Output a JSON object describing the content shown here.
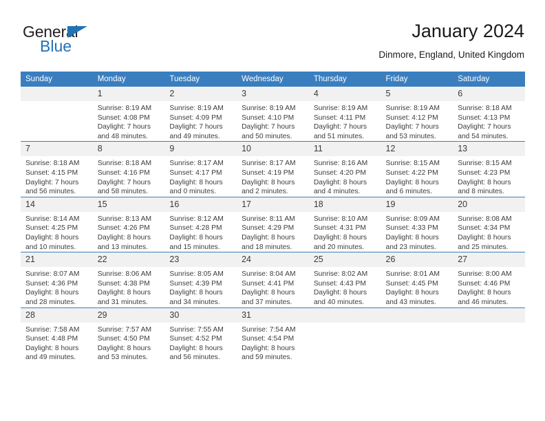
{
  "brand": {
    "name_part1": "General",
    "name_part2": "Blue",
    "triangle_color": "#2272b5"
  },
  "header": {
    "title": "January 2024",
    "subtitle": "Dinmore, England, United Kingdom"
  },
  "theme": {
    "header_blue": "#3a7ebf",
    "row_gray": "#f1f1f1",
    "text": "#3c3c3c"
  },
  "calendar": {
    "weekday_headers": [
      "Sunday",
      "Monday",
      "Tuesday",
      "Wednesday",
      "Thursday",
      "Friday",
      "Saturday"
    ],
    "weeks": [
      [
        {
          "day": "",
          "blank": true
        },
        {
          "day": "1",
          "sunrise": "Sunrise: 8:19 AM",
          "sunset": "Sunset: 4:08 PM",
          "daylight_l1": "Daylight: 7 hours",
          "daylight_l2": "and 48 minutes."
        },
        {
          "day": "2",
          "sunrise": "Sunrise: 8:19 AM",
          "sunset": "Sunset: 4:09 PM",
          "daylight_l1": "Daylight: 7 hours",
          "daylight_l2": "and 49 minutes."
        },
        {
          "day": "3",
          "sunrise": "Sunrise: 8:19 AM",
          "sunset": "Sunset: 4:10 PM",
          "daylight_l1": "Daylight: 7 hours",
          "daylight_l2": "and 50 minutes."
        },
        {
          "day": "4",
          "sunrise": "Sunrise: 8:19 AM",
          "sunset": "Sunset: 4:11 PM",
          "daylight_l1": "Daylight: 7 hours",
          "daylight_l2": "and 51 minutes."
        },
        {
          "day": "5",
          "sunrise": "Sunrise: 8:19 AM",
          "sunset": "Sunset: 4:12 PM",
          "daylight_l1": "Daylight: 7 hours",
          "daylight_l2": "and 53 minutes."
        },
        {
          "day": "6",
          "sunrise": "Sunrise: 8:18 AM",
          "sunset": "Sunset: 4:13 PM",
          "daylight_l1": "Daylight: 7 hours",
          "daylight_l2": "and 54 minutes."
        }
      ],
      [
        {
          "day": "7",
          "sunrise": "Sunrise: 8:18 AM",
          "sunset": "Sunset: 4:15 PM",
          "daylight_l1": "Daylight: 7 hours",
          "daylight_l2": "and 56 minutes."
        },
        {
          "day": "8",
          "sunrise": "Sunrise: 8:18 AM",
          "sunset": "Sunset: 4:16 PM",
          "daylight_l1": "Daylight: 7 hours",
          "daylight_l2": "and 58 minutes."
        },
        {
          "day": "9",
          "sunrise": "Sunrise: 8:17 AM",
          "sunset": "Sunset: 4:17 PM",
          "daylight_l1": "Daylight: 8 hours",
          "daylight_l2": "and 0 minutes."
        },
        {
          "day": "10",
          "sunrise": "Sunrise: 8:17 AM",
          "sunset": "Sunset: 4:19 PM",
          "daylight_l1": "Daylight: 8 hours",
          "daylight_l2": "and 2 minutes."
        },
        {
          "day": "11",
          "sunrise": "Sunrise: 8:16 AM",
          "sunset": "Sunset: 4:20 PM",
          "daylight_l1": "Daylight: 8 hours",
          "daylight_l2": "and 4 minutes."
        },
        {
          "day": "12",
          "sunrise": "Sunrise: 8:15 AM",
          "sunset": "Sunset: 4:22 PM",
          "daylight_l1": "Daylight: 8 hours",
          "daylight_l2": "and 6 minutes."
        },
        {
          "day": "13",
          "sunrise": "Sunrise: 8:15 AM",
          "sunset": "Sunset: 4:23 PM",
          "daylight_l1": "Daylight: 8 hours",
          "daylight_l2": "and 8 minutes."
        }
      ],
      [
        {
          "day": "14",
          "sunrise": "Sunrise: 8:14 AM",
          "sunset": "Sunset: 4:25 PM",
          "daylight_l1": "Daylight: 8 hours",
          "daylight_l2": "and 10 minutes."
        },
        {
          "day": "15",
          "sunrise": "Sunrise: 8:13 AM",
          "sunset": "Sunset: 4:26 PM",
          "daylight_l1": "Daylight: 8 hours",
          "daylight_l2": "and 13 minutes."
        },
        {
          "day": "16",
          "sunrise": "Sunrise: 8:12 AM",
          "sunset": "Sunset: 4:28 PM",
          "daylight_l1": "Daylight: 8 hours",
          "daylight_l2": "and 15 minutes."
        },
        {
          "day": "17",
          "sunrise": "Sunrise: 8:11 AM",
          "sunset": "Sunset: 4:29 PM",
          "daylight_l1": "Daylight: 8 hours",
          "daylight_l2": "and 18 minutes."
        },
        {
          "day": "18",
          "sunrise": "Sunrise: 8:10 AM",
          "sunset": "Sunset: 4:31 PM",
          "daylight_l1": "Daylight: 8 hours",
          "daylight_l2": "and 20 minutes."
        },
        {
          "day": "19",
          "sunrise": "Sunrise: 8:09 AM",
          "sunset": "Sunset: 4:33 PM",
          "daylight_l1": "Daylight: 8 hours",
          "daylight_l2": "and 23 minutes."
        },
        {
          "day": "20",
          "sunrise": "Sunrise: 8:08 AM",
          "sunset": "Sunset: 4:34 PM",
          "daylight_l1": "Daylight: 8 hours",
          "daylight_l2": "and 25 minutes."
        }
      ],
      [
        {
          "day": "21",
          "sunrise": "Sunrise: 8:07 AM",
          "sunset": "Sunset: 4:36 PM",
          "daylight_l1": "Daylight: 8 hours",
          "daylight_l2": "and 28 minutes."
        },
        {
          "day": "22",
          "sunrise": "Sunrise: 8:06 AM",
          "sunset": "Sunset: 4:38 PM",
          "daylight_l1": "Daylight: 8 hours",
          "daylight_l2": "and 31 minutes."
        },
        {
          "day": "23",
          "sunrise": "Sunrise: 8:05 AM",
          "sunset": "Sunset: 4:39 PM",
          "daylight_l1": "Daylight: 8 hours",
          "daylight_l2": "and 34 minutes."
        },
        {
          "day": "24",
          "sunrise": "Sunrise: 8:04 AM",
          "sunset": "Sunset: 4:41 PM",
          "daylight_l1": "Daylight: 8 hours",
          "daylight_l2": "and 37 minutes."
        },
        {
          "day": "25",
          "sunrise": "Sunrise: 8:02 AM",
          "sunset": "Sunset: 4:43 PM",
          "daylight_l1": "Daylight: 8 hours",
          "daylight_l2": "and 40 minutes."
        },
        {
          "day": "26",
          "sunrise": "Sunrise: 8:01 AM",
          "sunset": "Sunset: 4:45 PM",
          "daylight_l1": "Daylight: 8 hours",
          "daylight_l2": "and 43 minutes."
        },
        {
          "day": "27",
          "sunrise": "Sunrise: 8:00 AM",
          "sunset": "Sunset: 4:46 PM",
          "daylight_l1": "Daylight: 8 hours",
          "daylight_l2": "and 46 minutes."
        }
      ],
      [
        {
          "day": "28",
          "sunrise": "Sunrise: 7:58 AM",
          "sunset": "Sunset: 4:48 PM",
          "daylight_l1": "Daylight: 8 hours",
          "daylight_l2": "and 49 minutes."
        },
        {
          "day": "29",
          "sunrise": "Sunrise: 7:57 AM",
          "sunset": "Sunset: 4:50 PM",
          "daylight_l1": "Daylight: 8 hours",
          "daylight_l2": "and 53 minutes."
        },
        {
          "day": "30",
          "sunrise": "Sunrise: 7:55 AM",
          "sunset": "Sunset: 4:52 PM",
          "daylight_l1": "Daylight: 8 hours",
          "daylight_l2": "and 56 minutes."
        },
        {
          "day": "31",
          "sunrise": "Sunrise: 7:54 AM",
          "sunset": "Sunset: 4:54 PM",
          "daylight_l1": "Daylight: 8 hours",
          "daylight_l2": "and 59 minutes."
        },
        {
          "day": "",
          "blank": true
        },
        {
          "day": "",
          "blank": true
        },
        {
          "day": "",
          "blank": true
        }
      ]
    ]
  }
}
